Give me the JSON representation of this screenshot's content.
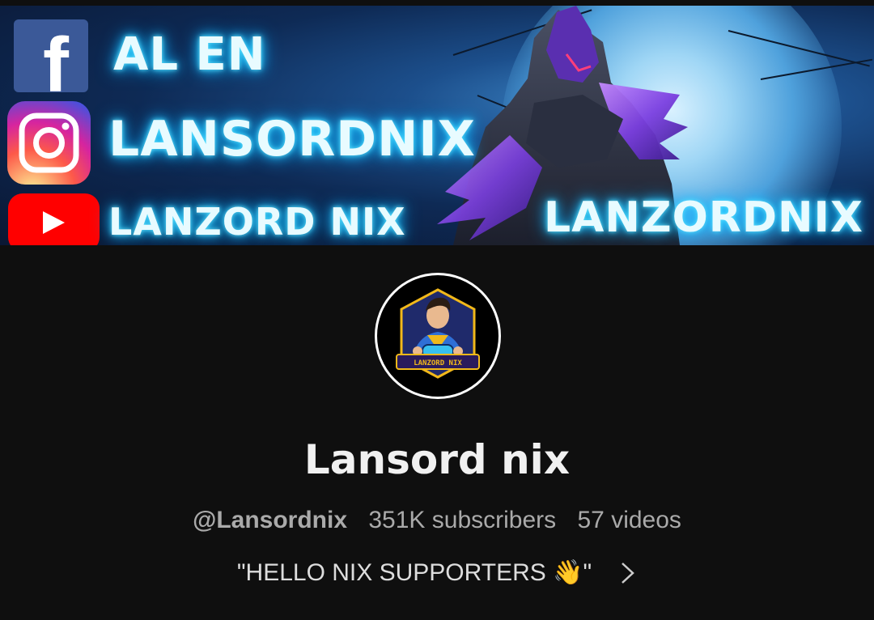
{
  "banner": {
    "line1": "AL EN",
    "line2": "LANSORDNIX",
    "line3": "LANZORD NIX",
    "right_text": "LANZORDNIX",
    "icons": [
      "facebook-icon",
      "instagram-icon",
      "youtube-icon"
    ],
    "facebook_glyph": "f"
  },
  "avatar": {
    "badge_text": "LANZORD NIX"
  },
  "channel": {
    "name": "Lansord nix",
    "handle": "@Lansordnix",
    "subscribers": "351K subscribers",
    "videos": "57 videos",
    "description": "\"HELLO NIX SUPPORTERS 👋\""
  },
  "colors": {
    "background": "#0f0f0f",
    "text_primary": "#f1f1f1",
    "text_secondary": "#aaaaaa",
    "neon": "#5fe3ff",
    "facebook": "#3b5998",
    "youtube": "#ff0000"
  }
}
